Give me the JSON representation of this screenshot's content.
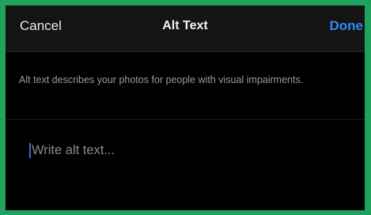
{
  "navbar": {
    "cancel_label": "Cancel",
    "title": "Alt Text",
    "done_label": "Done"
  },
  "description": {
    "text": "Alt text describes your photos for people with visual impairments."
  },
  "input": {
    "placeholder": "Write alt text...",
    "value": ""
  },
  "colors": {
    "accent": "#2d8cf0",
    "background": "#000000",
    "frame_border": "#1fa35c"
  }
}
